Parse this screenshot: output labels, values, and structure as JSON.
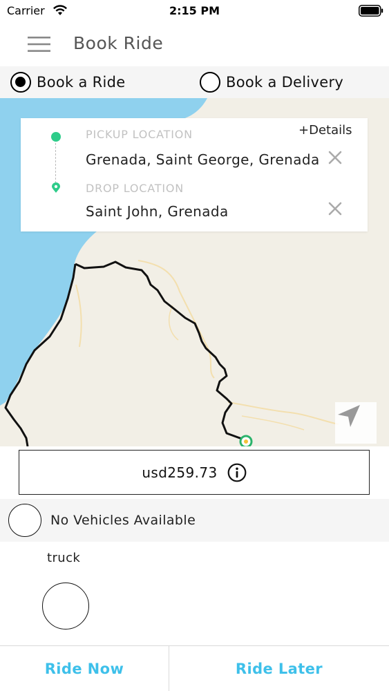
{
  "status_bar": {
    "carrier": "Carrier",
    "time": "2:15 PM"
  },
  "nav": {
    "title": "Book Ride",
    "menu_icon": "hamburger-menu-icon"
  },
  "ride_type": {
    "options": [
      {
        "label": "Book a Ride",
        "selected": true
      },
      {
        "label": "Book a Delivery",
        "selected": false
      }
    ]
  },
  "location_card": {
    "details_link": "+Details",
    "pickup": {
      "label": "PICKUP LOCATION",
      "value": "Grenada, Saint George, Grenada"
    },
    "drop": {
      "label": "DROP LOCATION",
      "value": "Saint John, Grenada"
    }
  },
  "fare": {
    "value": "usd259.73"
  },
  "vehicles": {
    "status": "No Vehicles Available",
    "type_name": "truck"
  },
  "actions": {
    "ride_now": "Ride Now",
    "ride_later": "Ride Later"
  },
  "colors": {
    "accent": "#3ec0ea",
    "pickup_green": "#2ecc8a",
    "sea": "#8fd1ee",
    "land": "#f2efe6"
  }
}
